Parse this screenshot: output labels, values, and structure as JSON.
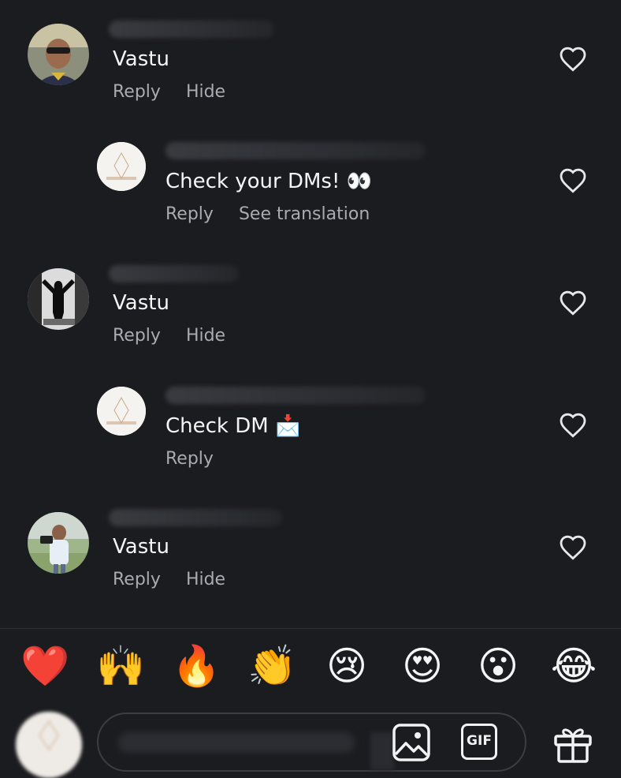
{
  "comments": [
    {
      "text": "Vastu",
      "actions": [
        "Reply",
        "Hide"
      ],
      "reply": false
    },
    {
      "text": "Check your DMs! 👀",
      "actions": [
        "Reply",
        "See translation"
      ],
      "reply": true
    },
    {
      "text": "Vastu",
      "actions": [
        "Reply",
        "Hide"
      ],
      "reply": false
    },
    {
      "text": "Check DM 📩",
      "actions": [
        "Reply"
      ],
      "reply": true
    },
    {
      "text": "Vastu",
      "actions": [
        "Reply",
        "Hide"
      ],
      "reply": false
    }
  ],
  "emoji_bar": [
    "❤️",
    "🙌",
    "🔥",
    "👏",
    "😢",
    "😍",
    "😮",
    "😂"
  ],
  "input": {
    "gif_label": "GIF"
  },
  "icons": {
    "heart": "heart-outline-icon",
    "image": "image-icon",
    "gift": "gift-icon"
  },
  "colors": {
    "background": "#1b1c20",
    "secondary_text": "#a9abb3",
    "primary_text": "#f5f5f5"
  }
}
